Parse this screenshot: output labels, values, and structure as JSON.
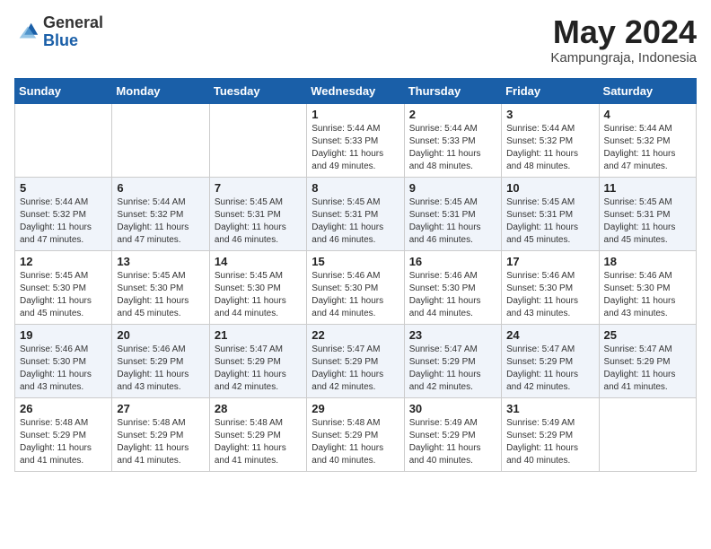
{
  "logo": {
    "general": "General",
    "blue": "Blue"
  },
  "header": {
    "month": "May 2024",
    "location": "Kampungraja, Indonesia"
  },
  "weekdays": [
    "Sunday",
    "Monday",
    "Tuesday",
    "Wednesday",
    "Thursday",
    "Friday",
    "Saturday"
  ],
  "weeks": [
    [
      {
        "day": "",
        "info": ""
      },
      {
        "day": "",
        "info": ""
      },
      {
        "day": "",
        "info": ""
      },
      {
        "day": "1",
        "info": "Sunrise: 5:44 AM\nSunset: 5:33 PM\nDaylight: 11 hours\nand 49 minutes."
      },
      {
        "day": "2",
        "info": "Sunrise: 5:44 AM\nSunset: 5:33 PM\nDaylight: 11 hours\nand 48 minutes."
      },
      {
        "day": "3",
        "info": "Sunrise: 5:44 AM\nSunset: 5:32 PM\nDaylight: 11 hours\nand 48 minutes."
      },
      {
        "day": "4",
        "info": "Sunrise: 5:44 AM\nSunset: 5:32 PM\nDaylight: 11 hours\nand 47 minutes."
      }
    ],
    [
      {
        "day": "5",
        "info": "Sunrise: 5:44 AM\nSunset: 5:32 PM\nDaylight: 11 hours\nand 47 minutes."
      },
      {
        "day": "6",
        "info": "Sunrise: 5:44 AM\nSunset: 5:32 PM\nDaylight: 11 hours\nand 47 minutes."
      },
      {
        "day": "7",
        "info": "Sunrise: 5:45 AM\nSunset: 5:31 PM\nDaylight: 11 hours\nand 46 minutes."
      },
      {
        "day": "8",
        "info": "Sunrise: 5:45 AM\nSunset: 5:31 PM\nDaylight: 11 hours\nand 46 minutes."
      },
      {
        "day": "9",
        "info": "Sunrise: 5:45 AM\nSunset: 5:31 PM\nDaylight: 11 hours\nand 46 minutes."
      },
      {
        "day": "10",
        "info": "Sunrise: 5:45 AM\nSunset: 5:31 PM\nDaylight: 11 hours\nand 45 minutes."
      },
      {
        "day": "11",
        "info": "Sunrise: 5:45 AM\nSunset: 5:31 PM\nDaylight: 11 hours\nand 45 minutes."
      }
    ],
    [
      {
        "day": "12",
        "info": "Sunrise: 5:45 AM\nSunset: 5:30 PM\nDaylight: 11 hours\nand 45 minutes."
      },
      {
        "day": "13",
        "info": "Sunrise: 5:45 AM\nSunset: 5:30 PM\nDaylight: 11 hours\nand 45 minutes."
      },
      {
        "day": "14",
        "info": "Sunrise: 5:45 AM\nSunset: 5:30 PM\nDaylight: 11 hours\nand 44 minutes."
      },
      {
        "day": "15",
        "info": "Sunrise: 5:46 AM\nSunset: 5:30 PM\nDaylight: 11 hours\nand 44 minutes."
      },
      {
        "day": "16",
        "info": "Sunrise: 5:46 AM\nSunset: 5:30 PM\nDaylight: 11 hours\nand 44 minutes."
      },
      {
        "day": "17",
        "info": "Sunrise: 5:46 AM\nSunset: 5:30 PM\nDaylight: 11 hours\nand 43 minutes."
      },
      {
        "day": "18",
        "info": "Sunrise: 5:46 AM\nSunset: 5:30 PM\nDaylight: 11 hours\nand 43 minutes."
      }
    ],
    [
      {
        "day": "19",
        "info": "Sunrise: 5:46 AM\nSunset: 5:30 PM\nDaylight: 11 hours\nand 43 minutes."
      },
      {
        "day": "20",
        "info": "Sunrise: 5:46 AM\nSunset: 5:29 PM\nDaylight: 11 hours\nand 43 minutes."
      },
      {
        "day": "21",
        "info": "Sunrise: 5:47 AM\nSunset: 5:29 PM\nDaylight: 11 hours\nand 42 minutes."
      },
      {
        "day": "22",
        "info": "Sunrise: 5:47 AM\nSunset: 5:29 PM\nDaylight: 11 hours\nand 42 minutes."
      },
      {
        "day": "23",
        "info": "Sunrise: 5:47 AM\nSunset: 5:29 PM\nDaylight: 11 hours\nand 42 minutes."
      },
      {
        "day": "24",
        "info": "Sunrise: 5:47 AM\nSunset: 5:29 PM\nDaylight: 11 hours\nand 42 minutes."
      },
      {
        "day": "25",
        "info": "Sunrise: 5:47 AM\nSunset: 5:29 PM\nDaylight: 11 hours\nand 41 minutes."
      }
    ],
    [
      {
        "day": "26",
        "info": "Sunrise: 5:48 AM\nSunset: 5:29 PM\nDaylight: 11 hours\nand 41 minutes."
      },
      {
        "day": "27",
        "info": "Sunrise: 5:48 AM\nSunset: 5:29 PM\nDaylight: 11 hours\nand 41 minutes."
      },
      {
        "day": "28",
        "info": "Sunrise: 5:48 AM\nSunset: 5:29 PM\nDaylight: 11 hours\nand 41 minutes."
      },
      {
        "day": "29",
        "info": "Sunrise: 5:48 AM\nSunset: 5:29 PM\nDaylight: 11 hours\nand 40 minutes."
      },
      {
        "day": "30",
        "info": "Sunrise: 5:49 AM\nSunset: 5:29 PM\nDaylight: 11 hours\nand 40 minutes."
      },
      {
        "day": "31",
        "info": "Sunrise: 5:49 AM\nSunset: 5:29 PM\nDaylight: 11 hours\nand 40 minutes."
      },
      {
        "day": "",
        "info": ""
      }
    ]
  ]
}
